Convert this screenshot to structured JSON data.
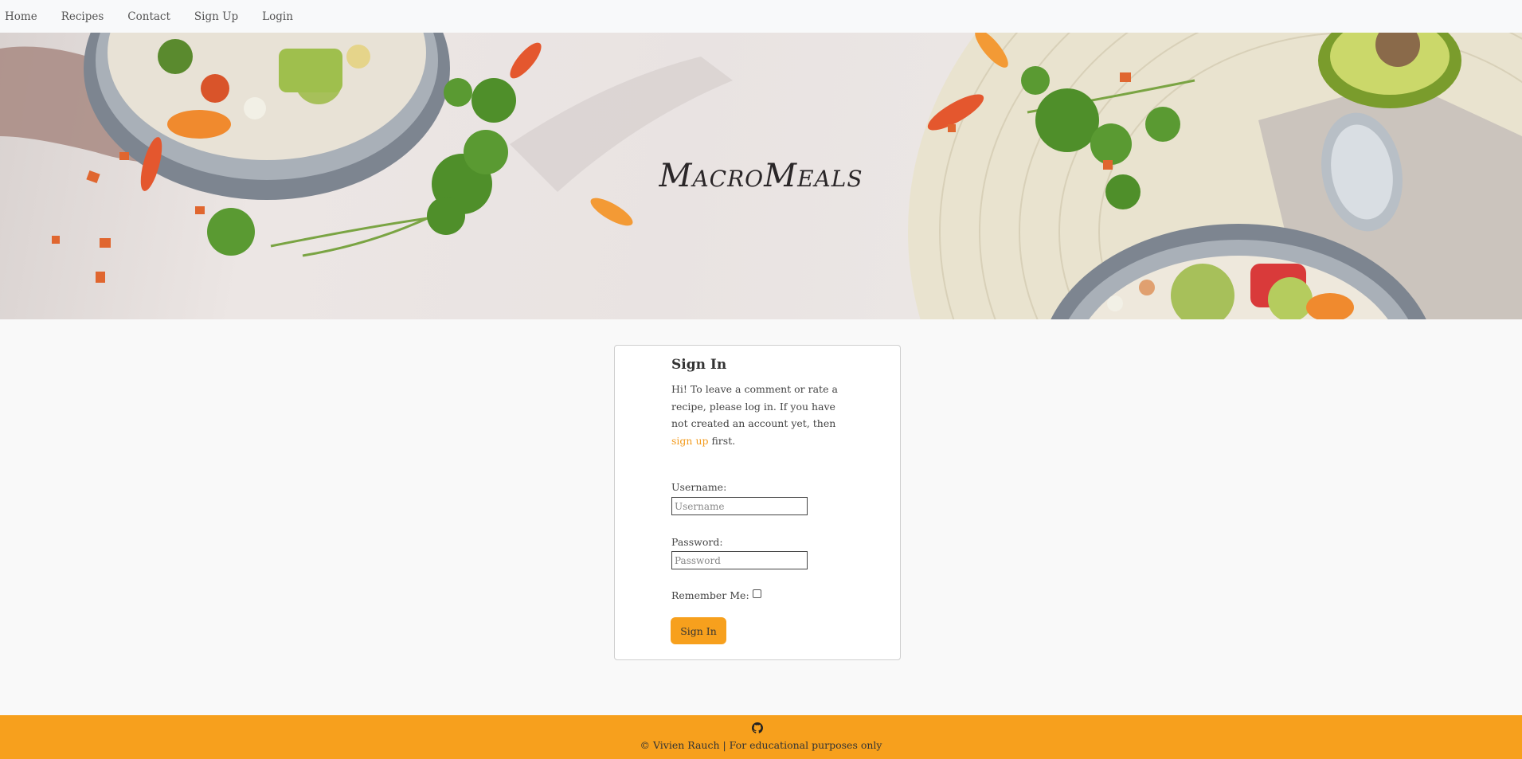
{
  "nav": {
    "items": [
      {
        "label": "Home"
      },
      {
        "label": "Recipes"
      },
      {
        "label": "Contact"
      },
      {
        "label": "Sign Up"
      },
      {
        "label": "Login"
      }
    ]
  },
  "hero": {
    "brand": "MacroMeals"
  },
  "signin": {
    "title": "Sign In",
    "intro_before": "Hi! To leave a comment or rate a recipe, please log in. If you have not created an account yet, then ",
    "signup_link": "sign up",
    "intro_after": " first.",
    "username_label": "Username:",
    "username_placeholder": "Username",
    "password_label": "Password:",
    "password_placeholder": "Password",
    "remember_label": "Remember Me:",
    "remember_checked": false,
    "button_label": "Sign In"
  },
  "footer": {
    "icon": "github-icon",
    "text": "© Vivien Rauch | For educational purposes only"
  },
  "colors": {
    "accent": "#f7a01d",
    "link": "#f39c1f",
    "navbar_bg": "#f8f9fa",
    "page_bg": "#f9f9f9"
  }
}
